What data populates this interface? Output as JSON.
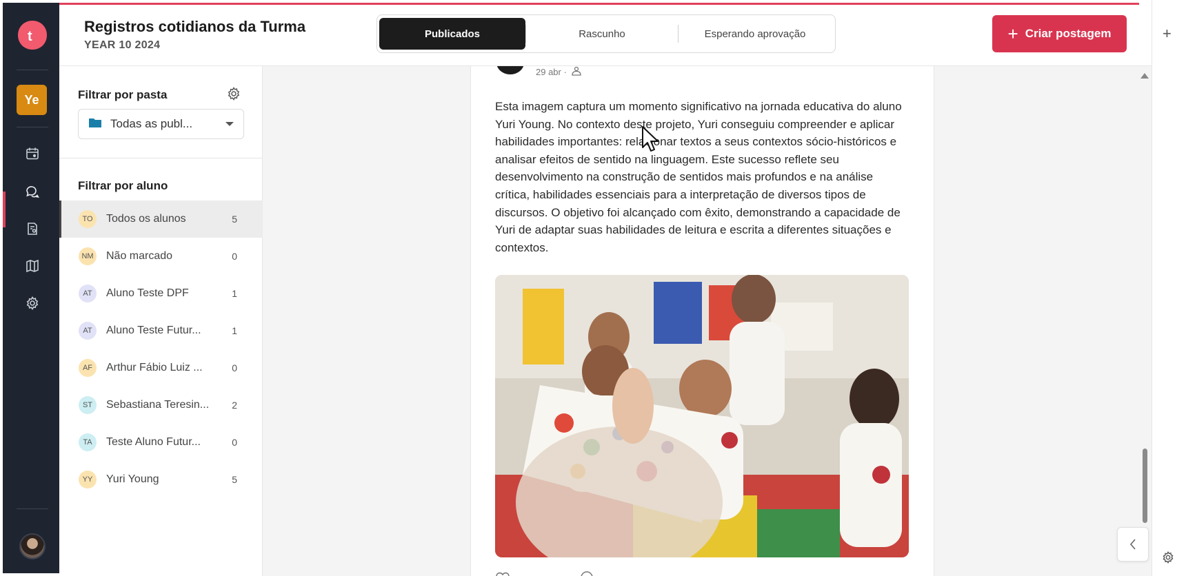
{
  "header": {
    "title": "Registros cotidianos da Turma",
    "subtitle": "YEAR 10 2024",
    "tabs": [
      "Publicados",
      "Rascunho",
      "Esperando aprovação"
    ],
    "create_label": "Criar postagem"
  },
  "rail": {
    "logo_letter": "t",
    "class_badge": "Ye"
  },
  "filters": {
    "folder_label": "Filtrar por pasta",
    "folder_value": "Todas as publ...",
    "student_label": "Filtrar por aluno",
    "students": [
      {
        "initials": "TO",
        "name": "Todos os alunos",
        "count": "5",
        "color": "#fbe3b0"
      },
      {
        "initials": "NM",
        "name": "Não marcado",
        "count": "0",
        "color": "#fbe3b0"
      },
      {
        "initials": "AT",
        "name": "Aluno Teste DPF",
        "count": "1",
        "color": "#e1e1f7"
      },
      {
        "initials": "AT",
        "name": "Aluno Teste Futur...",
        "count": "1",
        "color": "#e1e1f7"
      },
      {
        "initials": "AF",
        "name": "Arthur Fábio Luiz ...",
        "count": "0",
        "color": "#fbe3b0"
      },
      {
        "initials": "ST",
        "name": "Sebastiana Teresin...",
        "count": "2",
        "color": "#cdeef2"
      },
      {
        "initials": "TA",
        "name": "Teste Aluno Futur...",
        "count": "0",
        "color": "#cdeef2"
      },
      {
        "initials": "YY",
        "name": "Yuri Young",
        "count": "5",
        "color": "#fbe3b0"
      }
    ]
  },
  "post": {
    "date": "29 abr ·",
    "text": "Esta imagem captura um momento significativo na jornada educativa do aluno Yuri Young. No contexto deste projeto, Yuri conseguiu compreender e aplicar habilidades importantes: relacionar textos a seus contextos sócio-históricos e analisar efeitos de sentido na linguagem. Este sucesso reflete seu desenvolvimento na construção de sentidos mais profundos e na análise crítica, habilidades essenciais para a interpretação de diversos tipos de discursos. O objetivo foi alcançado com êxito, demonstrando a capacidade de Yuri de adaptar suas habilidades de leitura e escrita a diferentes situações e contextos."
  },
  "colors": {
    "accent": "#d9344f",
    "rail": "#1f2530",
    "badge": "#d88a12"
  }
}
